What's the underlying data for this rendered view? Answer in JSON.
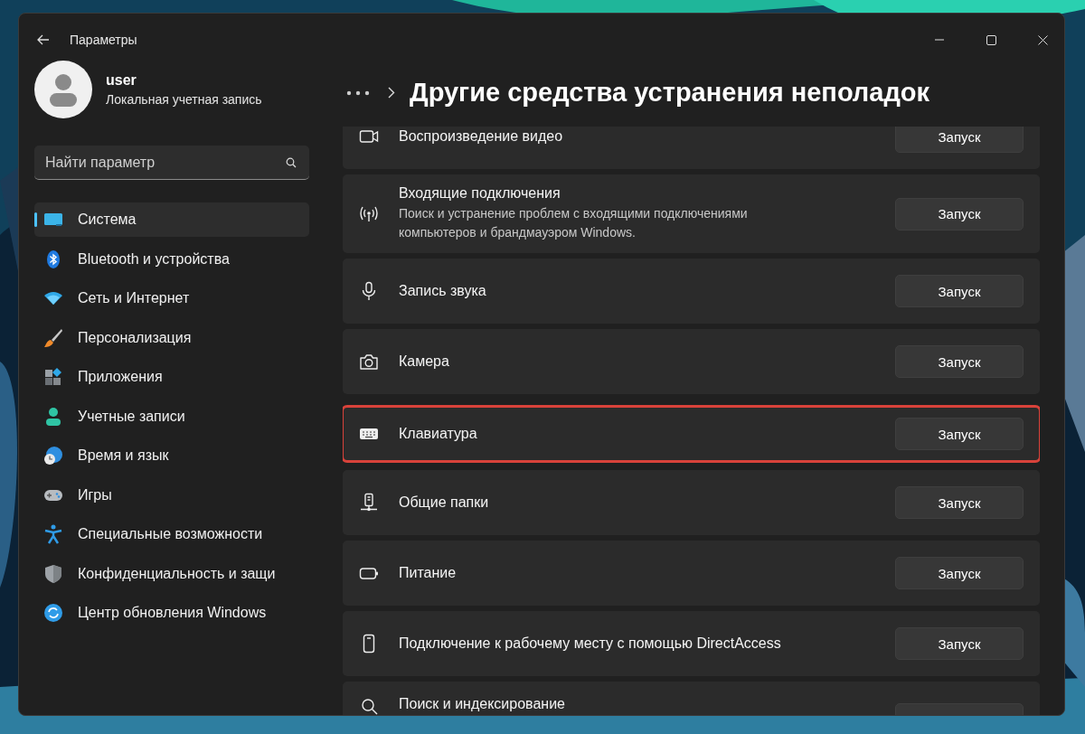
{
  "window": {
    "title": "Параметры"
  },
  "profile": {
    "name": "user",
    "account": "Локальная учетная запись"
  },
  "search": {
    "placeholder": "Найти параметр"
  },
  "nav": [
    {
      "label": "Система",
      "selected": true
    },
    {
      "label": "Bluetooth и устройства",
      "selected": false
    },
    {
      "label": "Сеть и Интернет",
      "selected": false
    },
    {
      "label": "Персонализация",
      "selected": false
    },
    {
      "label": "Приложения",
      "selected": false
    },
    {
      "label": "Учетные записи",
      "selected": false
    },
    {
      "label": "Время и язык",
      "selected": false
    },
    {
      "label": "Игры",
      "selected": false
    },
    {
      "label": "Специальные возможности",
      "selected": false
    },
    {
      "label": "Конфиденциальность и защи",
      "selected": false
    },
    {
      "label": "Центр обновления Windows",
      "selected": false
    }
  ],
  "page_title": "Другие средства устранения неполадок",
  "troubleshooters": [
    {
      "title": "Воспроизведение видео",
      "button": "Запуск",
      "highlighted": false
    },
    {
      "title": "Входящие подключения",
      "description": "Поиск и устранение проблем с входящими подключениями компьютеров и брандмауэром Windows.",
      "button": "Запуск",
      "highlighted": false
    },
    {
      "title": "Запись звука",
      "button": "Запуск",
      "highlighted": false
    },
    {
      "title": "Камера",
      "button": "Запуск",
      "highlighted": false
    },
    {
      "title": "Клавиатура",
      "button": "Запуск",
      "highlighted": true
    },
    {
      "title": "Общие папки",
      "button": "Запуск",
      "highlighted": false
    },
    {
      "title": "Питание",
      "button": "Запуск",
      "highlighted": false
    },
    {
      "title": "Подключение к рабочему месту с помощью DirectAccess",
      "button": "Запуск",
      "highlighted": false
    },
    {
      "title": "Поиск и индексирование",
      "highlighted": false
    }
  ]
}
